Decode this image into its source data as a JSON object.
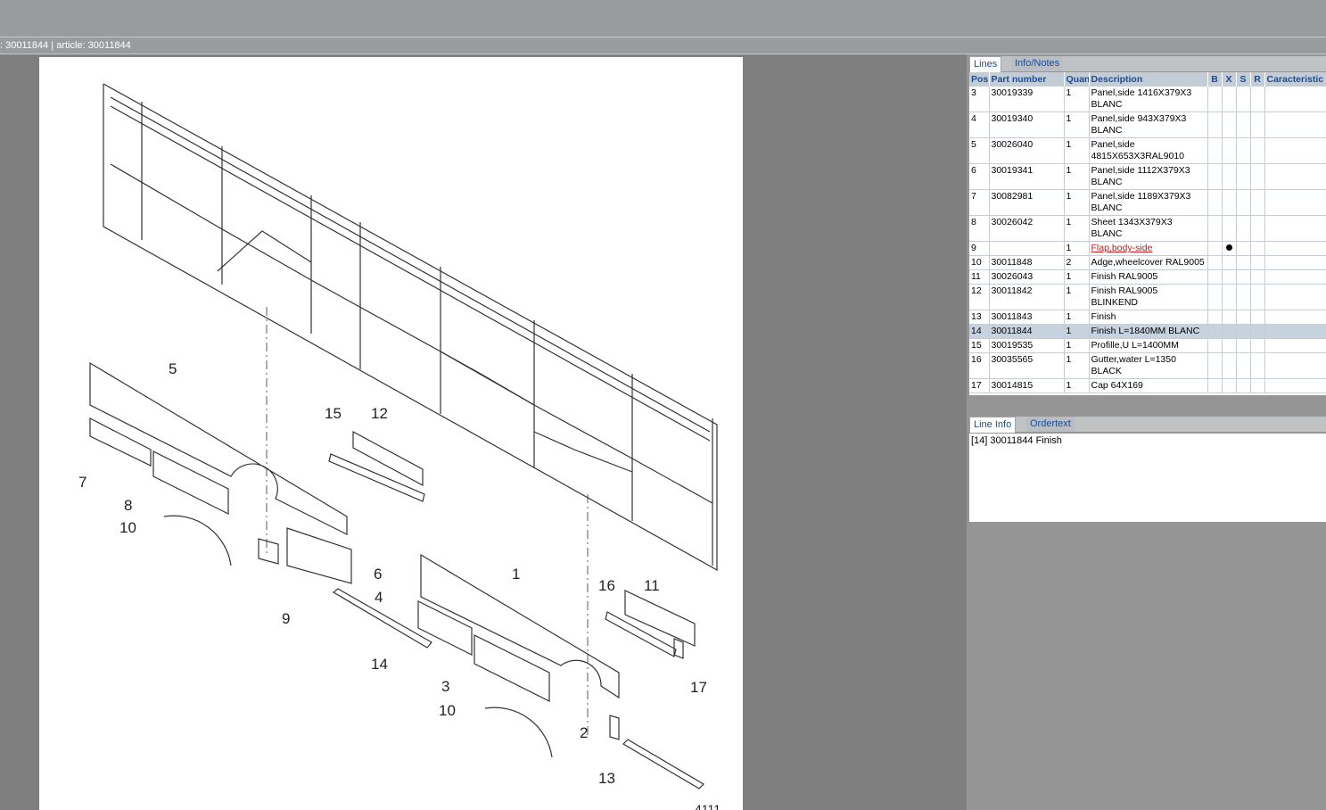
{
  "title_bar": ": 30011844 | article: 30011844",
  "tabs_top": [
    {
      "label": "Lines"
    },
    {
      "label": "Info/Notes"
    }
  ],
  "columns": [
    "Pos",
    "Part number",
    "Quan",
    "Description",
    "B",
    "X",
    "S",
    "R",
    "Caracteristic"
  ],
  "rows": [
    {
      "pos": "3",
      "part": "30019339",
      "qty": "1",
      "desc": "Panel,side 1416X379X3 BLANC"
    },
    {
      "pos": "4",
      "part": "30019340",
      "qty": "1",
      "desc": "Panel,side 943X379X3 BLANC"
    },
    {
      "pos": "5",
      "part": "30026040",
      "qty": "1",
      "desc": "Panel,side 4815X653X3RAL9010"
    },
    {
      "pos": "6",
      "part": "30019341",
      "qty": "1",
      "desc": "Panel,side 1112X379X3 BLANC"
    },
    {
      "pos": "7",
      "part": "30082981",
      "qty": "1",
      "desc": "Panel,side 1189X379X3 BLANC"
    },
    {
      "pos": "8",
      "part": "30026042",
      "qty": "1",
      "desc": "Sheet 1343X379X3 BLANC"
    },
    {
      "pos": "9",
      "part": "",
      "qty": "1",
      "desc": "Flap,body-side",
      "link": true,
      "x_dot": true
    },
    {
      "pos": "10",
      "part": "30011848",
      "qty": "2",
      "desc": "Adge,wheelcover RAL9005"
    },
    {
      "pos": "11",
      "part": "30026043",
      "qty": "1",
      "desc": "Finish RAL9005"
    },
    {
      "pos": "12",
      "part": "30011842",
      "qty": "1",
      "desc": "Finish RAL9005 BLINKEND"
    },
    {
      "pos": "13",
      "part": "30011843",
      "qty": "1",
      "desc": "Finish"
    },
    {
      "pos": "14",
      "part": "30011844",
      "qty": "1",
      "desc": "Finish L=1840MM BLANC",
      "selected": true
    },
    {
      "pos": "15",
      "part": "30019535",
      "qty": "1",
      "desc": "Profille,U L=1400MM"
    },
    {
      "pos": "16",
      "part": "30035565",
      "qty": "1",
      "desc": "Gutter,water L=1350 BLACK"
    },
    {
      "pos": "17",
      "part": "30014815",
      "qty": "1",
      "desc": "Cap 64X169"
    }
  ],
  "tabs_bottom": [
    {
      "label": "Line Info"
    },
    {
      "label": "Ordertext"
    }
  ],
  "line_info": "[14] 30011844 Finish",
  "diagram_labels": [
    "5",
    "15",
    "12",
    "7",
    "8",
    "10",
    "6",
    "9",
    "4",
    "1",
    "16",
    "11",
    "14",
    "3",
    "17",
    "10",
    "2",
    "13"
  ],
  "drawing_number_partial": "4111"
}
